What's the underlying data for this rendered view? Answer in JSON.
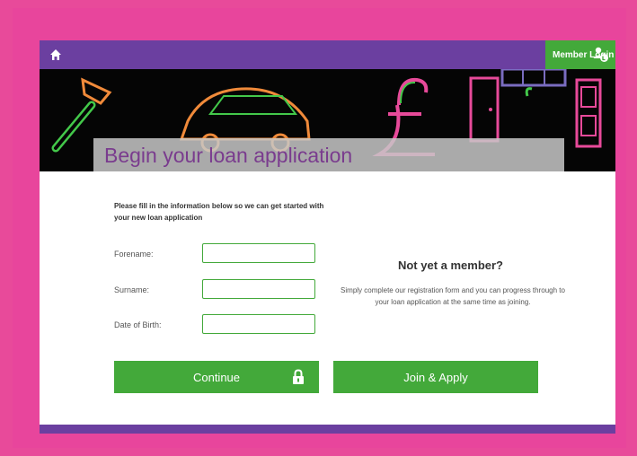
{
  "nav": {
    "home_icon": "home-icon",
    "member_login_label": "Member Login",
    "member_login_icon": "user-icon"
  },
  "hero": {
    "title": "Begin your loan application"
  },
  "form": {
    "intro": "Please fill in the information below so we can get started with your new loan application",
    "forename_label": "Forename:",
    "forename_value": "",
    "surname_label": "Surname:",
    "surname_value": "",
    "dob_label": "Date of Birth:",
    "dob_value": "",
    "continue_label": "Continue",
    "lock_icon": "lock-icon"
  },
  "join": {
    "title": "Not yet a member?",
    "text": "Simply complete our registration form and you can progress through to your loan application at the same time as joining.",
    "button_label": "Join & Apply"
  },
  "colors": {
    "pink_bg": "#e84a9a",
    "purple": "#6b3fa0",
    "green": "#43a93a"
  }
}
